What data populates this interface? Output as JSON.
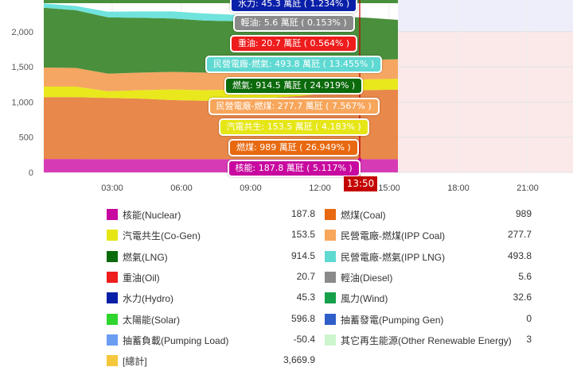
{
  "chart_data": {
    "type": "area",
    "y_ticks": [
      "0",
      "500",
      "1,000",
      "1,500",
      "2,000"
    ],
    "x_ticks": [
      "03:00",
      "06:00",
      "09:00",
      "12:00",
      "15:00",
      "18:00",
      "21:00"
    ],
    "ylim": [
      0,
      2450
    ],
    "current_time": "13:50",
    "series": [
      {
        "key": "nuclear",
        "color": "#d63bb5",
        "values": [
          190,
          190,
          188,
          188,
          188,
          188,
          188,
          188,
          188,
          188,
          188,
          188
        ]
      },
      {
        "key": "coal",
        "color": "#e8884a",
        "values": [
          880,
          880,
          870,
          860,
          840,
          830,
          840,
          870,
          900,
          950,
          980,
          989
        ]
      },
      {
        "key": "cogen",
        "color": "#e8e81c",
        "values": [
          150,
          150,
          95,
          120,
          150,
          150,
          150,
          150,
          150,
          150,
          153,
          153
        ]
      },
      {
        "key": "ipp_coal",
        "color": "#f5a662",
        "values": [
          270,
          265,
          250,
          250,
          250,
          250,
          250,
          260,
          270,
          275,
          278,
          278
        ]
      },
      {
        "key": "lng",
        "color": "#4a8f3c",
        "values": [
          850,
          820,
          800,
          780,
          760,
          740,
          720,
          700,
          680,
          650,
          600,
          560
        ]
      },
      {
        "key": "ipp_lng",
        "color": "#6fe3dc",
        "values": [
          60,
          60,
          80,
          90,
          100,
          100,
          90,
          50,
          20,
          10,
          0,
          0
        ]
      }
    ],
    "tooltips": [
      {
        "key": "hydro",
        "text": "水力: 45.3 萬瓩 ( 1.234% )",
        "bg": "#0a1fa8"
      },
      {
        "key": "diesel",
        "text": "輕油: 5.6 萬瓩 ( 0.153% )",
        "bg": "#8a8a8a"
      },
      {
        "key": "oil",
        "text": "重油: 20.7 萬瓩 ( 0.564% )",
        "bg": "#ee1c1c"
      },
      {
        "key": "ipp_lng",
        "text": "民營電廠-燃氣: 493.8 萬瓩 ( 13.455% )",
        "bg": "#5fd9d2"
      },
      {
        "key": "lng",
        "text": "燃氣: 914.5 萬瓩 ( 24.919% )",
        "bg": "#0b6a0b"
      },
      {
        "key": "ipp_coal",
        "text": "民營電廠-燃煤: 277.7 萬瓩 ( 7.567% )",
        "bg": "#f7a65c"
      },
      {
        "key": "cogen",
        "text": "汽電共生: 153.5 萬瓩 ( 4.183% )",
        "bg": "#e6e617"
      },
      {
        "key": "coal",
        "text": "燃煤: 989 萬瓩 ( 26.949% )",
        "bg": "#e8690f"
      },
      {
        "key": "nuclear",
        "text": "核能: 187.8 萬瓩 ( 5.117% )",
        "bg": "#c8099f"
      }
    ]
  },
  "legend": [
    {
      "label": "核能(Nuclear)",
      "value": "187.8",
      "color": "#c8099f"
    },
    {
      "label": "燃煤(Coal)",
      "value": "989",
      "color": "#e8690f"
    },
    {
      "label": "汽電共生(Co-Gen)",
      "value": "153.5",
      "color": "#e6e617"
    },
    {
      "label": "民營電廠-燃煤(IPP Coal)",
      "value": "277.7",
      "color": "#f7a65c"
    },
    {
      "label": "燃氣(LNG)",
      "value": "914.5",
      "color": "#0b6a0b"
    },
    {
      "label": "民營電廠-燃氣(IPP LNG)",
      "value": "493.8",
      "color": "#5fd9d2"
    },
    {
      "label": "重油(Oil)",
      "value": "20.7",
      "color": "#ee1c1c"
    },
    {
      "label": "輕油(Diesel)",
      "value": "5.6",
      "color": "#8a8a8a"
    },
    {
      "label": "水力(Hydro)",
      "value": "45.3",
      "color": "#0a1fa8"
    },
    {
      "label": "風力(Wind)",
      "value": "32.6",
      "color": "#16a04a"
    },
    {
      "label": "太陽能(Solar)",
      "value": "596.8",
      "color": "#2ed62e"
    },
    {
      "label": "抽蓄發電(Pumping Gen)",
      "value": "0",
      "color": "#2f5ec9"
    },
    {
      "label": "抽蓄負載(Pumping Load)",
      "value": "-50.4",
      "color": "#6b9df2"
    },
    {
      "label": "其它再生能源(Other Renewable Energy)",
      "value": "3",
      "color": "#ccf5cc"
    },
    {
      "label": "[總計]",
      "value": "3,669.9",
      "color": "#f5c73b"
    }
  ]
}
